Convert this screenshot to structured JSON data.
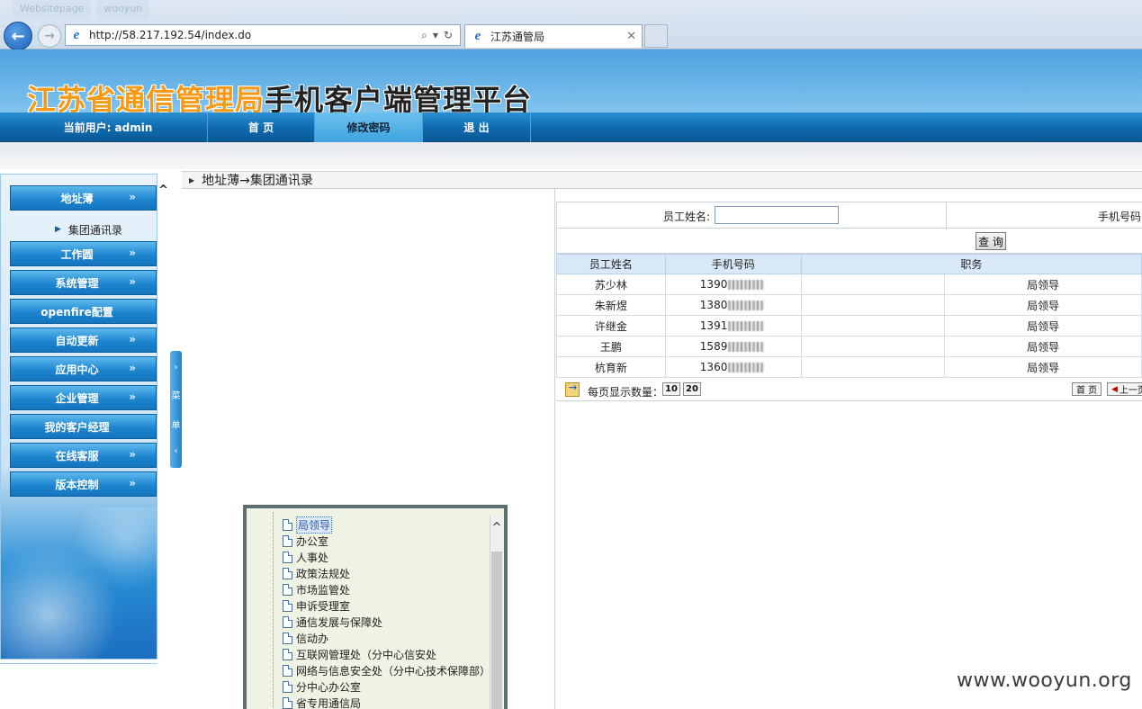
{
  "browser": {
    "url": "http://58.217.192.54/index.do",
    "tab_title": "江苏通管局",
    "ghost_tabs": [
      "Websitepage",
      "wooyun"
    ]
  },
  "site": {
    "title_colored": "江苏省通信管理局",
    "title_rest": "手机客户端管理平台"
  },
  "topnav": {
    "current_user": "当前用户: admin",
    "home": "首 页",
    "change_password": "修改密码",
    "logout": "退 出"
  },
  "sidebar": {
    "items": [
      {
        "label": "地址薄"
      },
      {
        "label": "工作圆"
      },
      {
        "label": "系统管理"
      },
      {
        "label": "openfire配置"
      },
      {
        "label": "自动更新"
      },
      {
        "label": "应用中心"
      },
      {
        "label": "企业管理"
      },
      {
        "label": "我的客户经理"
      },
      {
        "label": "在线客服"
      },
      {
        "label": "版本控制"
      }
    ],
    "sub_item": "集团通讯录",
    "menu_toggle": [
      "菜",
      "单"
    ]
  },
  "breadcrumb": "地址薄→集团通讯录",
  "search": {
    "name_label": "员工姓名:",
    "name_value": "",
    "phone_label": "手机号码",
    "query_button": "查 询"
  },
  "table": {
    "headers": [
      "员工姓名",
      "手机号码",
      "职务"
    ],
    "rows": [
      {
        "name": "苏少林",
        "phone": "1390",
        "title": "局领导"
      },
      {
        "name": "朱新煜",
        "phone": "1380",
        "title": "局领导"
      },
      {
        "name": "许继金",
        "phone": "1391",
        "title": "局领导"
      },
      {
        "name": "王鹏",
        "phone": "1589",
        "title": "局领导"
      },
      {
        "name": "杭育新",
        "phone": "1360",
        "title": "局领导"
      }
    ]
  },
  "pager": {
    "label": "每页显示数量：",
    "sizes": [
      "10",
      "20"
    ],
    "first": "首 页",
    "prev": "上一页"
  },
  "tree": {
    "items": [
      "局领导",
      "办公室",
      "人事处",
      "政策法规处",
      "市场监管处",
      "申诉受理室",
      "通信发展与保障处",
      "信动办",
      "互联网管理处（分中心信安处",
      "网络与信息安全处（分中心技术保障部）",
      "分中心办公室",
      "省专用通信局"
    ]
  },
  "watermark": "www.wooyun.org",
  "colors": {
    "nav_blue": "#0f69ad",
    "header_blue": "#4fa3e0",
    "title_orange": "#f49a16",
    "table_header": "#d8e8f6"
  }
}
